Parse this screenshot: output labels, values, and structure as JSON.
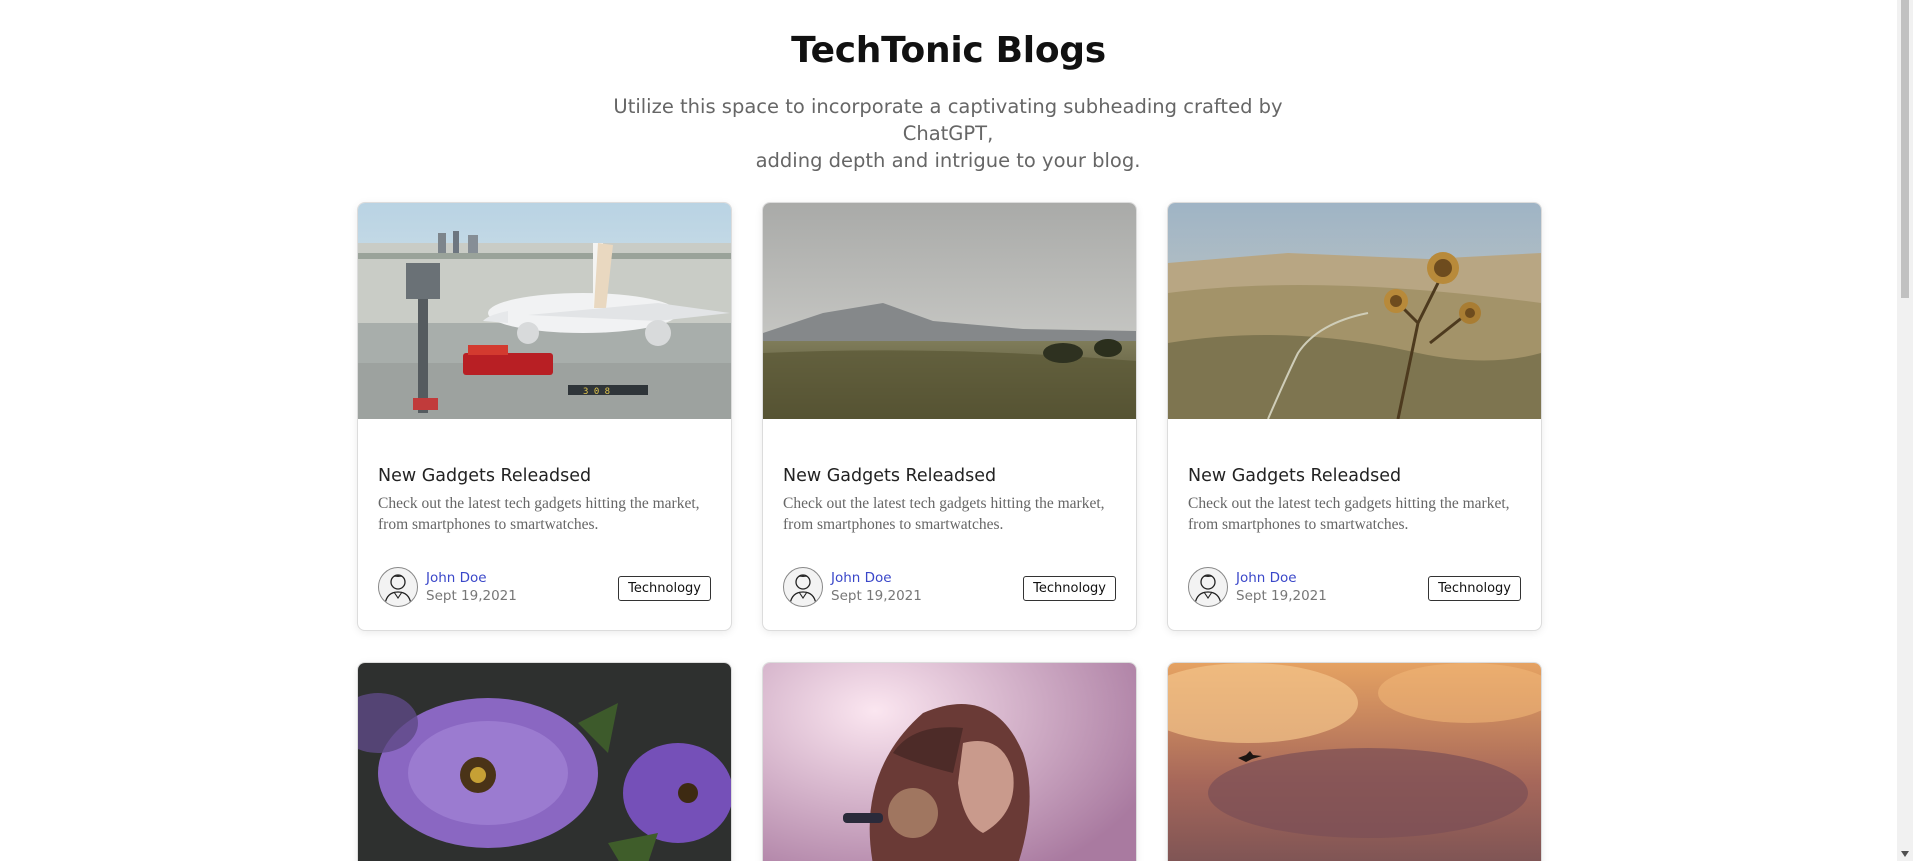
{
  "header": {
    "title": "TechTonic Blogs",
    "subtitle_line1": "Utilize this space to incorporate a captivating subheading crafted by ChatGPT,",
    "subtitle_line2": "adding depth and intrigue to your blog."
  },
  "cards": [
    {
      "image": "airplane-photo",
      "title": "New Gadgets Releadsed",
      "description": "Check out the latest tech gadgets hitting the market, from smartphones to smartwatches.",
      "author": "John Doe",
      "date": "Sept 19,2021",
      "tag": "Technology"
    },
    {
      "image": "grassland-photo",
      "title": "New Gadgets Releadsed",
      "description": "Check out the latest tech gadgets hitting the market, from smartphones to smartwatches.",
      "author": "John Doe",
      "date": "Sept 19,2021",
      "tag": "Technology"
    },
    {
      "image": "thistle-valley-photo",
      "title": "New Gadgets Releadsed",
      "description": "Check out the latest tech gadgets hitting the market, from smartphones to smartwatches.",
      "author": "John Doe",
      "date": "Sept 19,2021",
      "tag": "Technology"
    },
    {
      "image": "purple-flowers-photo"
    },
    {
      "image": "woman-portrait-photo"
    },
    {
      "image": "sunset-bird-photo"
    }
  ]
}
